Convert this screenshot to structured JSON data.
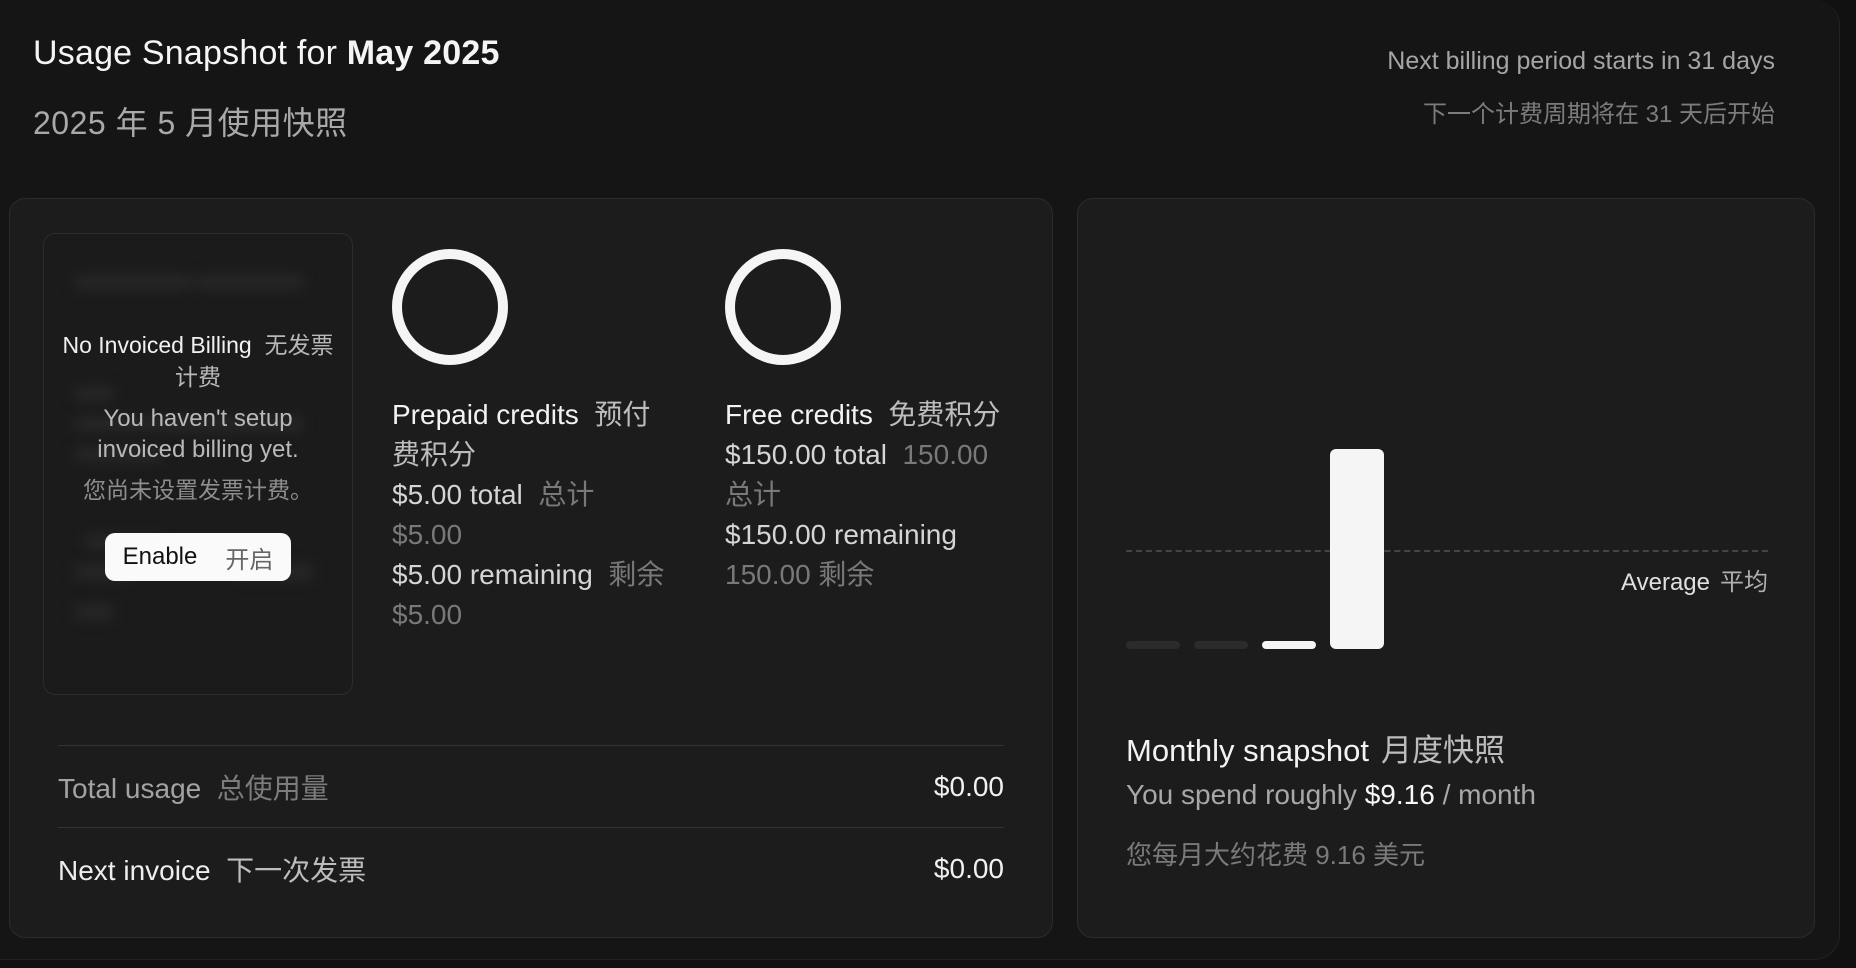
{
  "header": {
    "title_prefix": "Usage Snapshot for ",
    "title_month": "May 2025",
    "title_zh": "2025 年 5 月使用快照",
    "billing_en": "Next billing period starts in 31 days",
    "billing_zh": "下一个计费周期将在 31 天后开始"
  },
  "invoice": {
    "title": "No Invoiced Billing",
    "title_zh": "无发票计费",
    "description": "You haven't setup invoiced billing yet.",
    "description_zh": "您尚未设置发票计费。",
    "enable_label": "Enable",
    "enable_label_zh": "开启"
  },
  "prepaid": {
    "name": "Prepaid credits",
    "name_zh": "预付费积分",
    "total": "$5.00 total",
    "total_zh": "总计 $5.00",
    "remaining": "$5.00 remaining",
    "remaining_zh": "剩余 $5.00"
  },
  "free": {
    "name": "Free credits",
    "name_zh": "免费积分",
    "total": "$150.00 total",
    "total_zh": "150.00 总计",
    "remaining": "$150.00 remaining",
    "remaining_zh": "150.00 剩余"
  },
  "summary": {
    "total_usage_label": "Total usage",
    "total_usage_label_zh": "总使用量",
    "total_usage_value": "$0.00",
    "next_invoice_label": "Next invoice",
    "next_invoice_label_zh": "下一次发票",
    "next_invoice_value": "$0.00"
  },
  "snapshot": {
    "title": "Monthly snapshot",
    "title_zh": "月度快照",
    "spend_prefix": "You spend roughly ",
    "spend_amount": "$9.16",
    "spend_suffix": " / month",
    "spend_zh": "您每月大约花费 9.16 美元",
    "average_label": "Average",
    "average_label_zh": "平均"
  },
  "chart_data": {
    "type": "bar",
    "values": [
      0,
      0,
      0.5,
      18.5
    ],
    "average": 9.16,
    "ylim": [
      0,
      18.5
    ],
    "grid": false,
    "colors": [
      "#2b2b2b",
      "#2b2b2b",
      "#f5f5f5",
      "#f5f5f5"
    ]
  },
  "colors": {
    "background": "#151515",
    "card": "#1c1c1c",
    "accent": "#f5f5f5"
  }
}
